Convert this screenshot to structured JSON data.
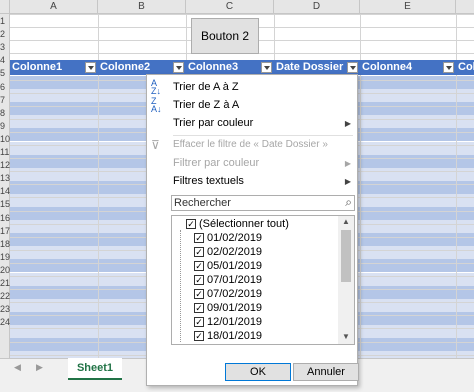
{
  "columns": [
    "A",
    "B",
    "C",
    "D",
    "E"
  ],
  "row_numbers": [
    "1",
    "2",
    "3",
    "4",
    "5",
    "6",
    "7",
    "8",
    "9",
    "10",
    "11",
    "12",
    "13",
    "14",
    "15",
    "16",
    "17",
    "18",
    "19",
    "20",
    "21",
    "22",
    "23",
    "24"
  ],
  "table_headers": [
    "Colonne1",
    "Colonne2",
    "Colonne3",
    "Date Dossier",
    "Colonne4",
    "Colo"
  ],
  "button_label": "Bouton 2",
  "sheet_tab": "Sheet1",
  "colors": {
    "header_blue": "#4472c4",
    "band_light": "#d9e1f2",
    "band_lighter": "#b4c6e7"
  },
  "menu": {
    "sort_asc": "Trier de A à Z",
    "sort_desc": "Trier de Z à A",
    "sort_color": "Trier par couleur",
    "clear_filter": "Effacer le filtre de « Date Dossier »",
    "filter_color": "Filtrer par couleur",
    "text_filters": "Filtres textuels",
    "search_placeholder": "Rechercher",
    "items": [
      "(Sélectionner tout)",
      "01/02/2019",
      "02/02/2019",
      "05/01/2019",
      "07/01/2019",
      "07/02/2019",
      "09/01/2019",
      "12/01/2019",
      "18/01/2019"
    ],
    "ok": "OK",
    "cancel": "Annuler"
  }
}
